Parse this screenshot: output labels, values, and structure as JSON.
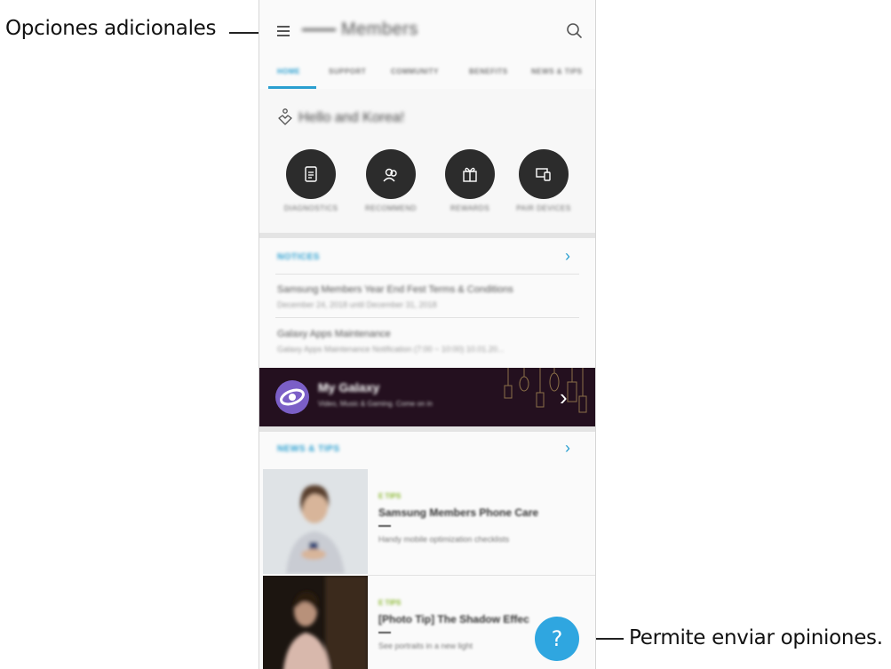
{
  "callouts": {
    "left": "Opciones adicionales",
    "right": "Permite enviar opiniones."
  },
  "appbar": {
    "title": "Members",
    "menu_icon": "hamburger-menu-icon",
    "search_icon": "search-icon"
  },
  "tabs": [
    {
      "label": "HOME",
      "active": true
    },
    {
      "label": "SUPPORT",
      "active": false
    },
    {
      "label": "COMMUNITY",
      "active": false
    },
    {
      "label": "BENEFITS",
      "active": false
    },
    {
      "label": "NEWS & TIPS",
      "active": false
    }
  ],
  "welcome": {
    "greeting": "Hello and Korea!",
    "actions": [
      {
        "label": "DIAGNOSTICS",
        "icon": "document-icon"
      },
      {
        "label": "RECOMMEND",
        "icon": "people-icon"
      },
      {
        "label": "REWARDS",
        "icon": "gift-icon"
      },
      {
        "label": "PAIR DEVICES",
        "icon": "devices-icon"
      }
    ]
  },
  "notices": {
    "title": "NOTICES",
    "items": [
      {
        "title": "Samsung Members Year End Fest Terms & Conditions",
        "sub": "December 24, 2018 until December 31, 2018"
      },
      {
        "title": "Galaxy Apps Maintenance",
        "sub": "Galaxy Apps Maintenance Notification (7:00 ~ 10:00) 10.01.20..."
      }
    ]
  },
  "banner": {
    "title": "My Galaxy",
    "sub": "Video, Music & Gaming. Come on in",
    "logo_icon": "galaxy-logo-icon"
  },
  "news": {
    "title": "NEWS & TIPS",
    "cards": [
      {
        "tag": "E TIPS",
        "title": "Samsung Members Phone Care",
        "sub": "Handy mobile optimization checklists"
      },
      {
        "tag": "E TIPS",
        "title": "[Photo Tip] The Shadow Effec",
        "sub": "See portraits in a new light"
      }
    ]
  },
  "fab": {
    "label": "?",
    "icon": "feedback-icon"
  },
  "colors": {
    "accent": "#2a9fd0",
    "fab": "#2fa6e0",
    "action_bg": "#2c2c2c",
    "banner_bg": "#24101f"
  }
}
